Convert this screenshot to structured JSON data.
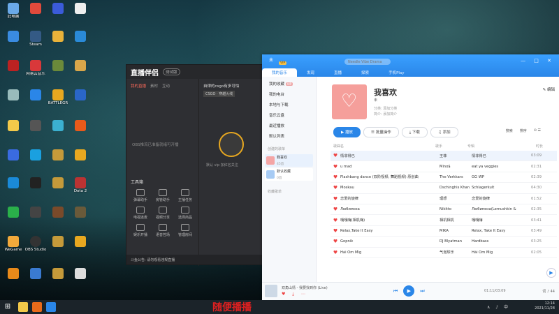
{
  "desktop": {
    "icons": [
      {
        "label": "此电脑",
        "color": "#6aa9e8"
      },
      {
        "label": "百度网盘",
        "color": "#e9b23a"
      },
      {
        "label": "Steam",
        "color": "#345a85"
      },
      {
        "label": "网易云音乐",
        "color": "#d9383a"
      },
      {
        "label": "BATTLEGR",
        "color": "#e8a820"
      },
      {
        "label": "OBS Studio",
        "color": "#333"
      },
      {
        "label": "WeGame",
        "color": "#f2a93b"
      },
      {
        "label": "Dota 2",
        "color": "#b33"
      }
    ]
  },
  "live_tool": {
    "logo": "直播伴侣",
    "version": "测试版",
    "tabs": [
      "我的直播",
      "素材",
      "互动"
    ],
    "empty_text": "OBS推流已准备就绪可开播",
    "tools_heading": "工具箱",
    "tools": [
      "弹幕助手",
      "房管助手",
      "主播任务",
      "电视连麦",
      "视频分享",
      "选择商品",
      "娱乐开播",
      "语音控场",
      "管理房间"
    ],
    "game_label": "自律的csgo有多可怕",
    "game_tag": "CSGO · 穿越火线",
    "hint": "默认 vip 加红名关注",
    "notice": "斗鱼公告: 请勿观看违规直播"
  },
  "music": {
    "user": "未",
    "vip": "VIP",
    "search_placeholder": "Needle Vibe Drama",
    "top_tabs": [
      "我的音乐",
      "发现",
      "直播",
      "探索",
      "手机Play"
    ],
    "window_buttons": "— □ ✕",
    "sidebar": {
      "items": [
        "我的收藏",
        "我的电台",
        "本地与下载",
        "音乐云盘",
        "最近播放",
        "默认列表"
      ],
      "vip_tag": "VIP",
      "section_created": "创建的歌单",
      "section_collected": "收藏歌单",
      "playlists": [
        {
          "name": "我喜欢",
          "count": "45首"
        },
        {
          "name": "默认收藏",
          "count": "0首"
        }
      ]
    },
    "playlist": {
      "name": "我喜欢",
      "creator": "未",
      "meta_line1": "分类: 添加分类",
      "meta_line2": "简介: 添加简介",
      "edit": "编辑"
    },
    "actions": [
      "播放",
      "批量操作",
      "下载",
      "添加"
    ],
    "sort": [
      "搜索",
      "排序"
    ],
    "table_headers": [
      "歌曲名",
      "歌手",
      "专辑",
      "时长"
    ],
    "songs": [
      {
        "title": "情非得已",
        "artist": "王菲",
        "album": "情非得已",
        "time": "03:09"
      },
      {
        "title": "u mad",
        "artist": "Mino$",
        "album": "eat ya veggies",
        "time": "02:31"
      },
      {
        "title": "Flashbang dance (双阶视频, 舞蹈视频) 原创曲",
        "artist": "The Verkkars",
        "album": "GG WP",
        "time": "02:39"
      },
      {
        "title": "Moskau",
        "artist": "Dschinghis Khan",
        "album": "Schlagerkult",
        "time": "04:30"
      },
      {
        "title": "恋爱的旋律",
        "artist": "理想",
        "album": "恋爱的旋律",
        "time": "01:52"
      },
      {
        "title": "Любимоза",
        "artist": "Nikitto",
        "album": "Любимоза(Lemushkin &",
        "time": "02:35"
      },
      {
        "title": "嘎嘎嗨(相机嗨)",
        "artist": "相机相机",
        "album": "嘎嘎嗨",
        "time": "03:41"
      },
      {
        "title": "Relax,Take It Easy",
        "artist": "MIKA",
        "album": "Relax, Take It Easy",
        "time": "03:49"
      },
      {
        "title": "Gopnik",
        "artist": "DJ Blyatman",
        "album": "Hardbass",
        "time": "03:25"
      },
      {
        "title": "Hải Ôm Mig",
        "artist": "气泡球乐",
        "album": "Hải Ôm Mig",
        "time": "02:05"
      }
    ],
    "player": {
      "title": "双角山情 - 我要找到你 (Live)",
      "time": "01:11/03:09",
      "volume": "44",
      "right_label": "词"
    }
  },
  "taskbar": {
    "time": "12:14",
    "date": "2021/11/28",
    "tray": "∧ ♪ 中"
  },
  "caption": "随便播播"
}
